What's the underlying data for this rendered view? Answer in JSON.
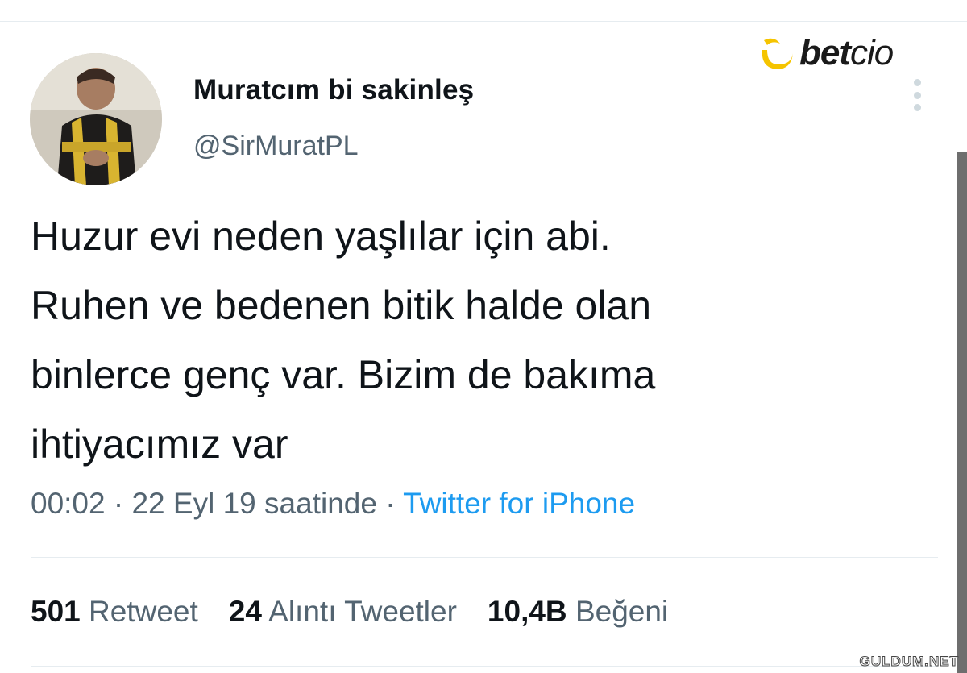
{
  "user": {
    "display_name": "Muratcım bi sakinleş",
    "handle": "@SirMuratPL"
  },
  "brand": {
    "bold": "bet",
    "light": "cio"
  },
  "tweet": {
    "text": "Huzur evi neden yaşlılar için abi.\nRuhen ve bedenen bitik halde olan\nbinlerce genç var. Bizim de bakıma\nihtiyacımız var",
    "time": "00:02",
    "date": "22 Eyl 19 saatinde",
    "separator": "·",
    "source": "Twitter for iPhone"
  },
  "stats": {
    "retweets_count": "501",
    "retweets_label": "Retweet",
    "quotes_count": "24",
    "quotes_label": "Alıntı Tweetler",
    "likes_count": "10,4B",
    "likes_label": "Beğeni"
  },
  "watermark": "GULDUM.NET",
  "icons": {
    "more": "more-vertical-icon",
    "avatar": "avatar-photo"
  },
  "colors": {
    "accent": "#1d9bf0",
    "text": "#0f1419",
    "secondary": "#536471",
    "brand_yellow": "#f5c400"
  }
}
